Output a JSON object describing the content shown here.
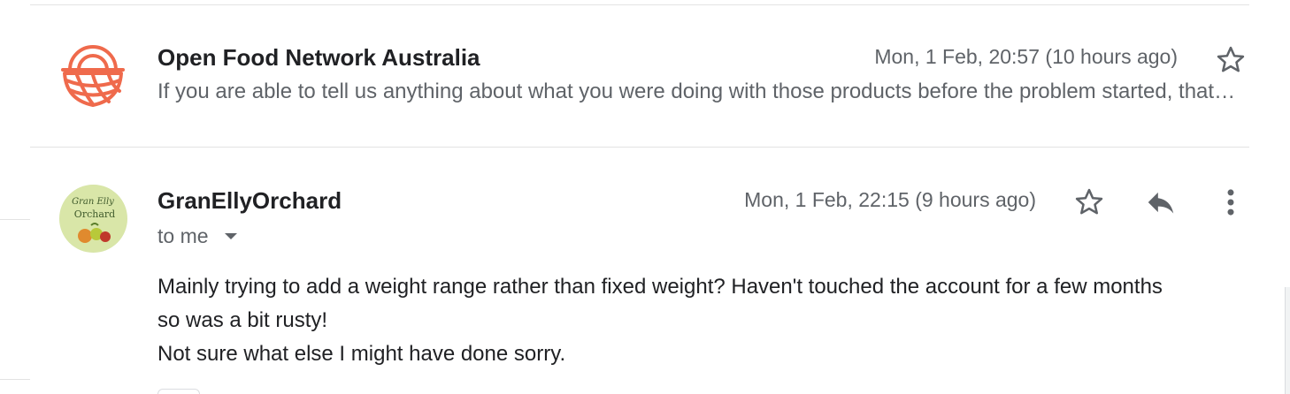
{
  "thread": {
    "messages": [
      {
        "sender": "Open Food Network Australia",
        "timestamp": "Mon, 1 Feb, 20:57 (10 hours ago)",
        "snippet": "If you are able to tell us anything about what you were doing with those products before the problem started, that would help us greatly to track down what went wrong.",
        "avatar_icon": "basket-logo-icon",
        "accent_color": "#ef6a4c"
      },
      {
        "sender": "GranEllyOrchard",
        "timestamp": "Mon, 1 Feb, 22:15 (9 hours ago)",
        "recipient": "to me",
        "avatar_icon": "orchard-logo-icon",
        "avatar_text_line1": "Gran Elly",
        "avatar_text_line2": "Orchard",
        "body": [
          "Mainly trying to add a weight range rather than fixed weight? Haven't touched the account for a few months",
          "so was a bit rusty!",
          "Not sure what else I might have done sorry."
        ]
      }
    ]
  }
}
